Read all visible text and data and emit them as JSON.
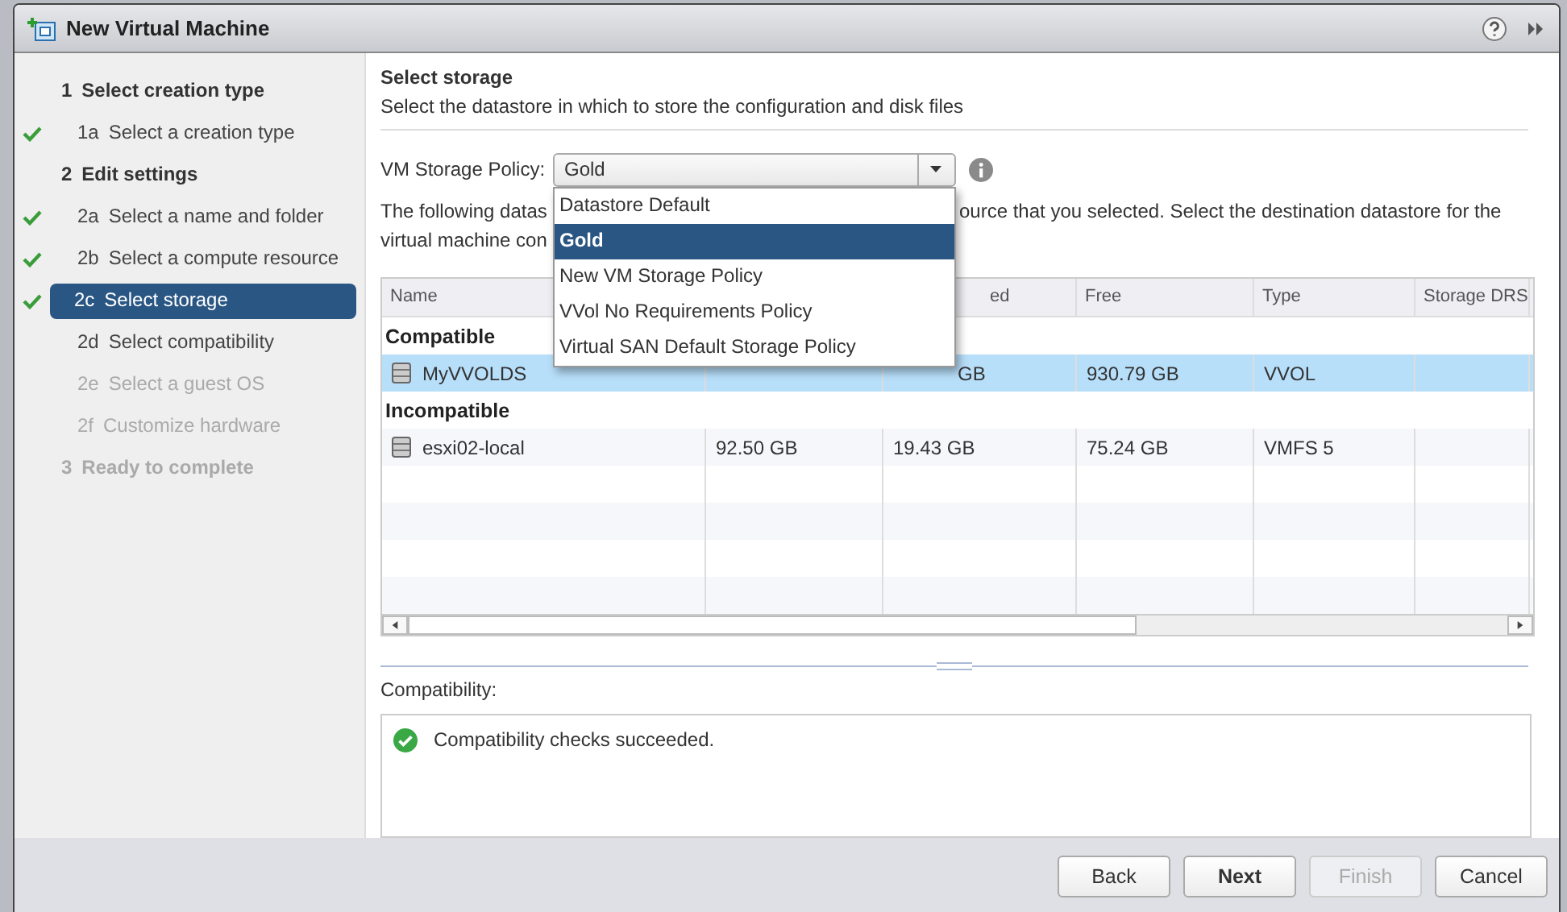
{
  "window": {
    "title": "New Virtual Machine"
  },
  "steps": [
    {
      "number": "1",
      "label": "Select creation type",
      "disabled": false,
      "children": [
        {
          "number": "1a",
          "label": "Select a creation type",
          "done": true,
          "selected": false,
          "disabled": false
        }
      ]
    },
    {
      "number": "2",
      "label": "Edit settings",
      "disabled": false,
      "children": [
        {
          "number": "2a",
          "label": "Select a name and folder",
          "done": true,
          "selected": false,
          "disabled": false
        },
        {
          "number": "2b",
          "label": "Select a compute resource",
          "done": true,
          "selected": false,
          "disabled": false
        },
        {
          "number": "2c",
          "label": "Select storage",
          "done": true,
          "selected": true,
          "disabled": false
        },
        {
          "number": "2d",
          "label": "Select compatibility",
          "done": false,
          "selected": false,
          "disabled": false
        },
        {
          "number": "2e",
          "label": "Select a guest OS",
          "done": false,
          "selected": false,
          "disabled": true
        },
        {
          "number": "2f",
          "label": "Customize hardware",
          "done": false,
          "selected": false,
          "disabled": true
        }
      ]
    },
    {
      "number": "3",
      "label": "Ready to complete",
      "disabled": true
    }
  ],
  "page": {
    "title": "Select storage",
    "subtitle": "Select the datastore in which to store the configuration and disk files"
  },
  "policy": {
    "label": "VM Storage Policy:",
    "value": "Gold",
    "options": [
      {
        "label": "Datastore Default",
        "selected": false
      },
      {
        "label": "Gold",
        "selected": true
      },
      {
        "label": "New VM Storage Policy",
        "selected": false
      },
      {
        "label": "VVol No Requirements Policy",
        "selected": false
      },
      {
        "label": "Virtual SAN Default Storage Policy",
        "selected": false
      }
    ]
  },
  "description": {
    "line_1_start": "The following datas",
    "line_1_end": "ource that you selected. Select the destination datastore for the",
    "line_2_start": "virtual machine con"
  },
  "table": {
    "columns": [
      "Name",
      "",
      "ed",
      "Free",
      "Type",
      "Storage DRS"
    ],
    "rows": [
      {
        "kind": "group",
        "label": "Compatible"
      },
      {
        "kind": "datastore",
        "selected": true,
        "cells": [
          "MyVVOLDS",
          "",
          "GB",
          "930.79 GB",
          "VVOL",
          ""
        ]
      },
      {
        "kind": "group",
        "label": "Incompatible"
      },
      {
        "kind": "datastore",
        "selected": false,
        "cells": [
          "esxi02-local",
          "92.50 GB",
          "19.43 GB",
          "75.24 GB",
          "VMFS 5",
          ""
        ]
      }
    ]
  },
  "compatibility": {
    "label": "Compatibility:",
    "message": "Compatibility checks succeeded."
  },
  "buttons": [
    {
      "label": "Back",
      "primary": false,
      "disabled": false
    },
    {
      "label": "Next",
      "primary": true,
      "disabled": false
    },
    {
      "label": "Finish",
      "primary": false,
      "disabled": true
    },
    {
      "label": "Cancel",
      "primary": false,
      "disabled": false
    }
  ]
}
